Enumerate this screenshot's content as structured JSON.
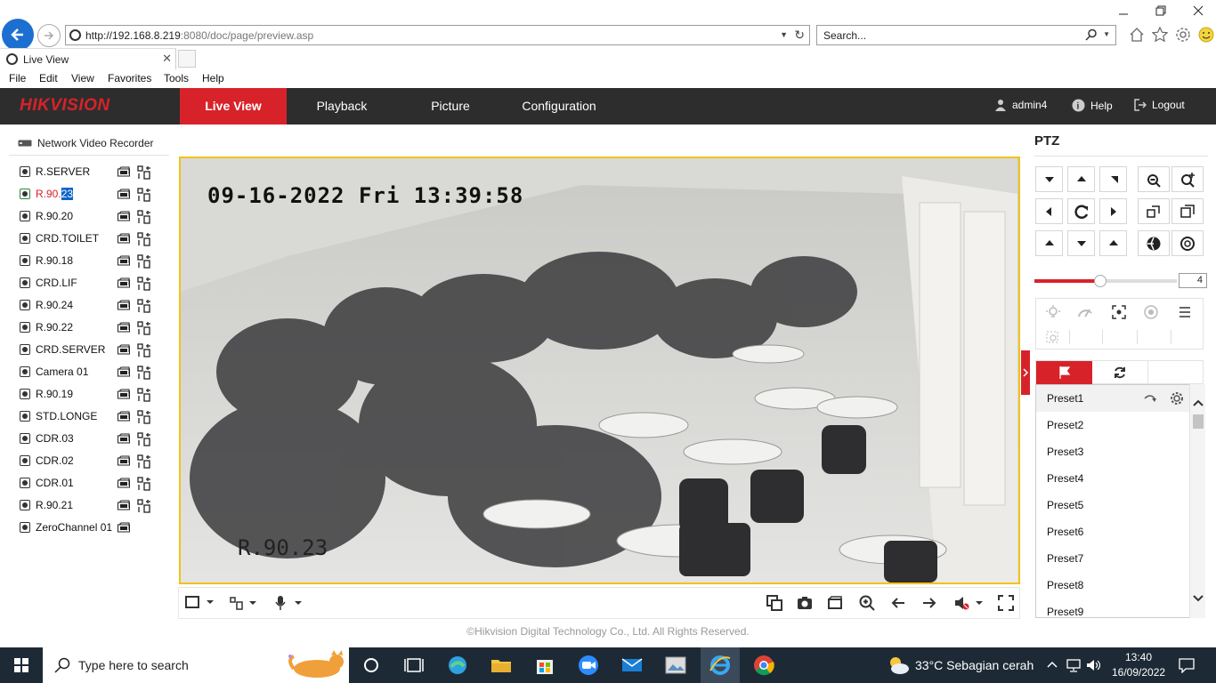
{
  "browser": {
    "url_prefix": "http://192.168.8.219",
    "url_rest": ":8080/doc/page/preview.asp",
    "search_placeholder": "Search...",
    "tab_title": "Live View",
    "menu": [
      "File",
      "Edit",
      "View",
      "Favorites",
      "Tools",
      "Help"
    ]
  },
  "app": {
    "logo": "HIKVISION",
    "nav": [
      "Live View",
      "Playback",
      "Picture",
      "Configuration"
    ],
    "user": "admin4",
    "help": "Help",
    "logout": "Logout",
    "colors": {
      "accent": "#d8222a",
      "header": "#2d2d2d",
      "video_border": "#f0c419"
    }
  },
  "sidebar": {
    "title": "Network Video Recorder",
    "channels": [
      {
        "name": "R.SERVER"
      },
      {
        "name": "R.90.",
        "highlight": "23",
        "active": true
      },
      {
        "name": "R.90.20"
      },
      {
        "name": "CRD.TOILET"
      },
      {
        "name": "R.90.18"
      },
      {
        "name": "CRD.LIF"
      },
      {
        "name": "R.90.24"
      },
      {
        "name": "R.90.22"
      },
      {
        "name": "CRD.SERVER"
      },
      {
        "name": "Camera 01"
      },
      {
        "name": "R.90.19"
      },
      {
        "name": "STD.LONGE"
      },
      {
        "name": "CDR.03"
      },
      {
        "name": "CDR.02"
      },
      {
        "name": "CDR.01"
      },
      {
        "name": "R.90.21"
      },
      {
        "name": "ZeroChannel 01",
        "zero": true
      }
    ]
  },
  "video": {
    "osd_time": "09-16-2022 Fri 13:39:58",
    "osd_name": "R.90.23"
  },
  "footer": {
    "copyright": "©Hikvision Digital Technology Co., Ltd. All Rights Reserved."
  },
  "ptz": {
    "title": "PTZ",
    "speed": 4,
    "speed_max": 7,
    "presets": [
      "Preset1",
      "Preset2",
      "Preset3",
      "Preset4",
      "Preset5",
      "Preset6",
      "Preset7",
      "Preset8",
      "Preset9"
    ]
  },
  "taskbar": {
    "search_placeholder": "Type here to search",
    "weather": "33°C  Sebagian cerah",
    "time": "13:40",
    "date": "16/09/2022"
  }
}
